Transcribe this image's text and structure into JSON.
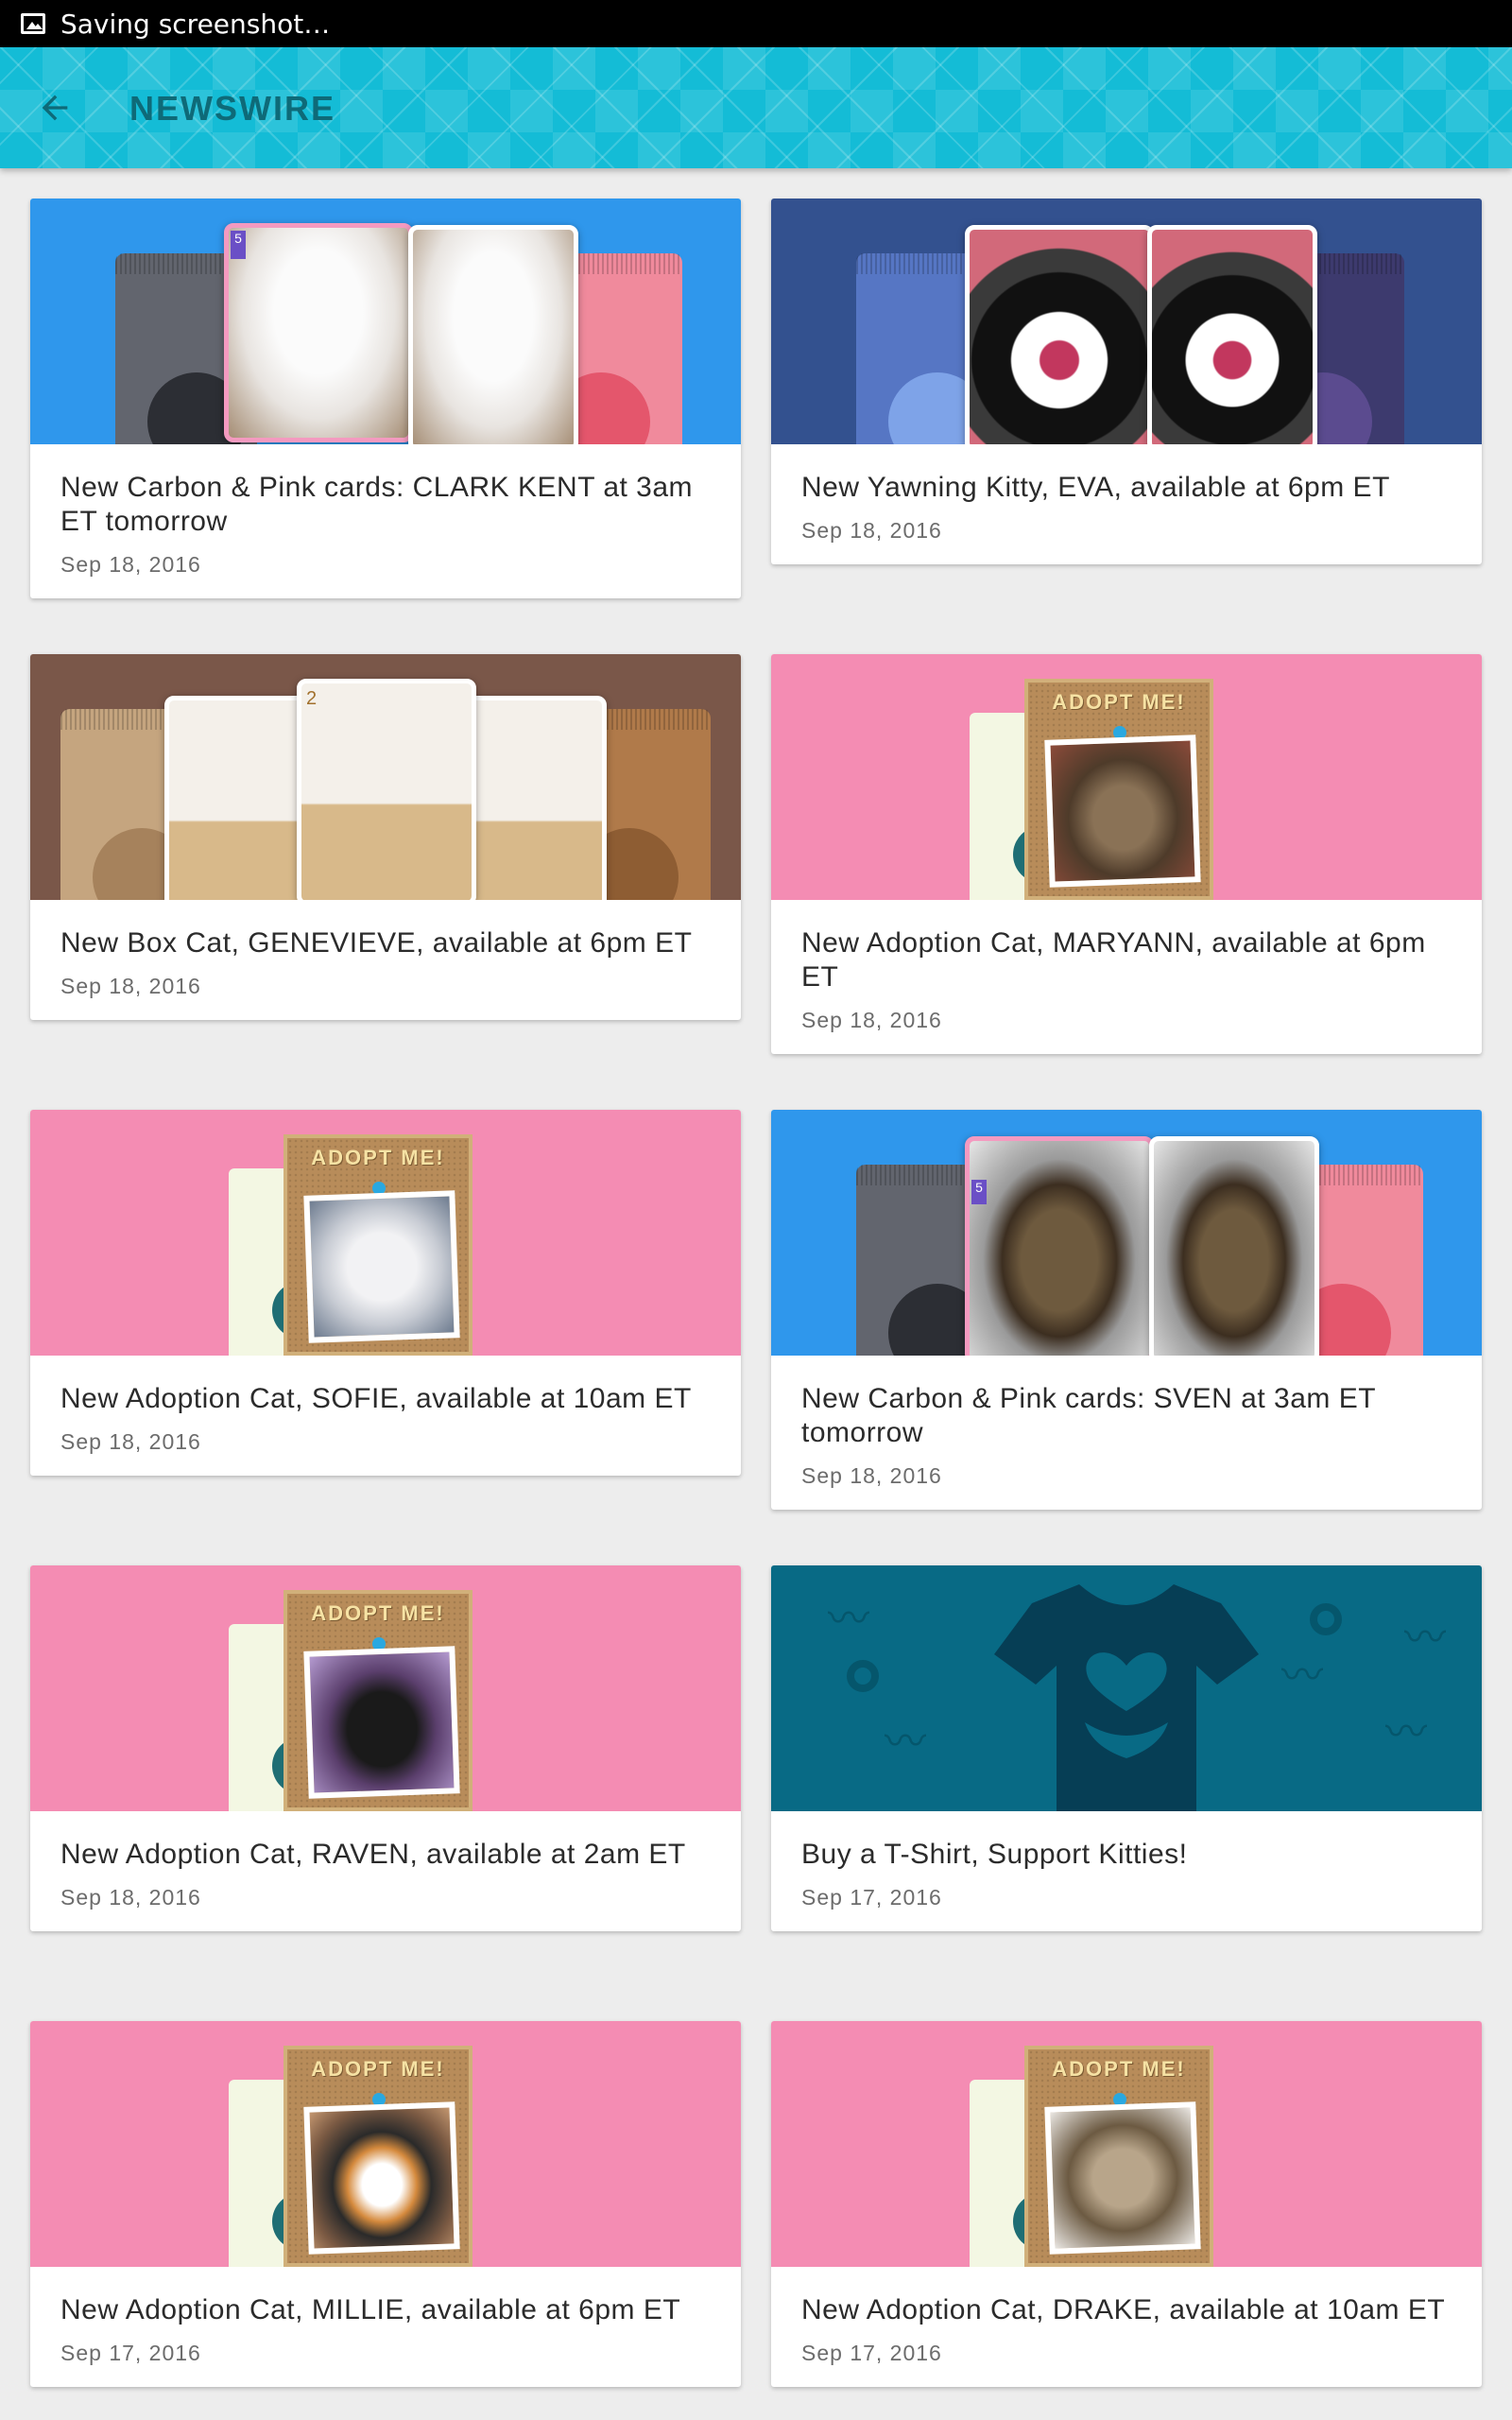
{
  "status_bar": {
    "text": "Saving screenshot…"
  },
  "app_bar": {
    "title": "NEWSWIRE"
  },
  "colors": {
    "accent": "#14bcd6",
    "title": "#0e6a78",
    "pink": "#f48cb3",
    "blue": "#2f97ec",
    "navy": "#33518f",
    "brown": "#7a5749",
    "teal": "#086a85"
  },
  "cards": [
    {
      "headline": "New Carbon & Pink cards: CLARK KENT at 3am ET tomorrow",
      "date": "Sep 18, 2016",
      "banner": "carbon-pink-blue"
    },
    {
      "headline": "New Yawning Kitty, EVA, available at 6pm ET",
      "date": "Sep 18, 2016",
      "banner": "yawning-kitty"
    },
    {
      "headline": "New Box Cat, GENEVIEVE, available at 6pm ET",
      "date": "Sep 18, 2016",
      "banner": "box-cat"
    },
    {
      "headline": "New Adoption Cat, MARYANN, available at 6pm ET",
      "date": "Sep 18, 2016",
      "banner": "adoption"
    },
    {
      "headline": "New Adoption Cat, SOFIE, available at 10am ET",
      "date": "Sep 18, 2016",
      "banner": "adoption"
    },
    {
      "headline": "New Carbon & Pink cards: SVEN at 3am ET tomorrow",
      "date": "Sep 18, 2016",
      "banner": "carbon-pink-blue"
    },
    {
      "headline": "New Adoption Cat, RAVEN, available at 2am ET",
      "date": "Sep 18, 2016",
      "banner": "adoption"
    },
    {
      "headline": "Buy a T-Shirt, Support Kitties!",
      "date": "Sep 17, 2016",
      "banner": "tshirt"
    },
    {
      "headline": "New Adoption Cat, MILLIE, available at 6pm ET",
      "date": "Sep 17, 2016",
      "banner": "adoption"
    },
    {
      "headline": "New Adoption Cat, DRAKE, available at 10am ET",
      "date": "Sep 17, 2016",
      "banner": "adoption"
    }
  ],
  "adopt_sign": "ADOPT ME!",
  "card_numbers": {
    "vol": "5",
    "box": "2"
  }
}
